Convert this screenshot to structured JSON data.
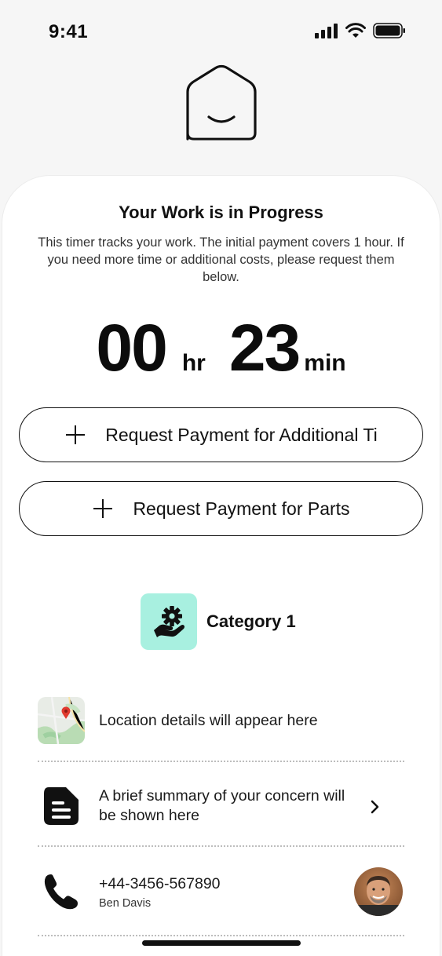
{
  "status": {
    "time": "9:41",
    "icons": [
      "signal-icon",
      "wifi-icon",
      "battery-icon"
    ]
  },
  "logo": {
    "icon": "house-smile-icon"
  },
  "progress": {
    "title": "Your Work is in Progress",
    "description": "This timer tracks your work. The initial payment covers 1 hour. If you need more time or additional costs, please request them below."
  },
  "timer": {
    "hours": "00",
    "hours_unit": "hr",
    "minutes": "23",
    "minutes_unit": "min"
  },
  "actions": {
    "additional_time_label": "Request Payment for Additional Ti",
    "parts_label": "Request Payment for Parts"
  },
  "category": {
    "label": "Category 1",
    "icon": "hand-gear-icon",
    "icon_bg": "#a8f0e0"
  },
  "details": {
    "location": "Location details will appear here",
    "summary": "A brief summary of your concern will be shown here",
    "phone": "+44-3456-567890",
    "contact_name": "Ben Davis"
  }
}
